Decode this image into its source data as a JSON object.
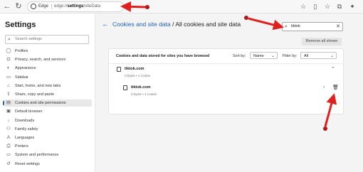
{
  "browser": {
    "back_icon": "arrow-left-icon",
    "refresh_icon": "refresh-icon",
    "tab_name": "Edge",
    "url_prefix": "edge://",
    "url_bold": "settings",
    "url_suffix": "/siteData",
    "toolbar_icons": [
      "star-icon",
      "split-screen-icon",
      "favorites-icon",
      "collections-icon",
      "copilot-icon"
    ]
  },
  "sidebar": {
    "title": "Settings",
    "search_placeholder": "Search settings",
    "items": [
      {
        "label": "Profiles",
        "icon": "profile-icon"
      },
      {
        "label": "Privacy, search, and services",
        "icon": "lock-icon"
      },
      {
        "label": "Appearance",
        "icon": "appearance-icon"
      },
      {
        "label": "Sidebar",
        "icon": "sidebar-icon"
      },
      {
        "label": "Start, home, and new tabs",
        "icon": "home-icon"
      },
      {
        "label": "Share, copy and paste",
        "icon": "share-icon"
      },
      {
        "label": "Cookies and site permissions",
        "icon": "cookie-icon",
        "active": true
      },
      {
        "label": "Default browser",
        "icon": "browser-icon"
      },
      {
        "label": "Downloads",
        "icon": "download-icon"
      },
      {
        "label": "Family safety",
        "icon": "family-icon"
      },
      {
        "label": "Languages",
        "icon": "language-icon"
      },
      {
        "label": "Printers",
        "icon": "printer-icon"
      },
      {
        "label": "System and performance",
        "icon": "system-icon"
      },
      {
        "label": "Reset settings",
        "icon": "reset-icon"
      }
    ]
  },
  "main": {
    "breadcrumb_link": "Cookies and site data",
    "breadcrumb_sep": " / ",
    "breadcrumb_current": "All cookies and site data",
    "search_value": "tiktok",
    "remove_all_label": "Remove all shown",
    "card": {
      "title": "Cookies and data stored for sites you have browsed",
      "sort_label": "Sort by:",
      "sort_value": "Name",
      "filter_label": "Filter by:",
      "filter_value": "All",
      "site": {
        "name": "tiktok.com",
        "meta": "0 bytes • 1 cookie",
        "child": {
          "name": "tiktok.com",
          "meta": "0 bytes • 1 cookie"
        }
      }
    }
  },
  "annotations": {
    "arrow_color": "#e0201d",
    "dot_color": "#b01818"
  }
}
